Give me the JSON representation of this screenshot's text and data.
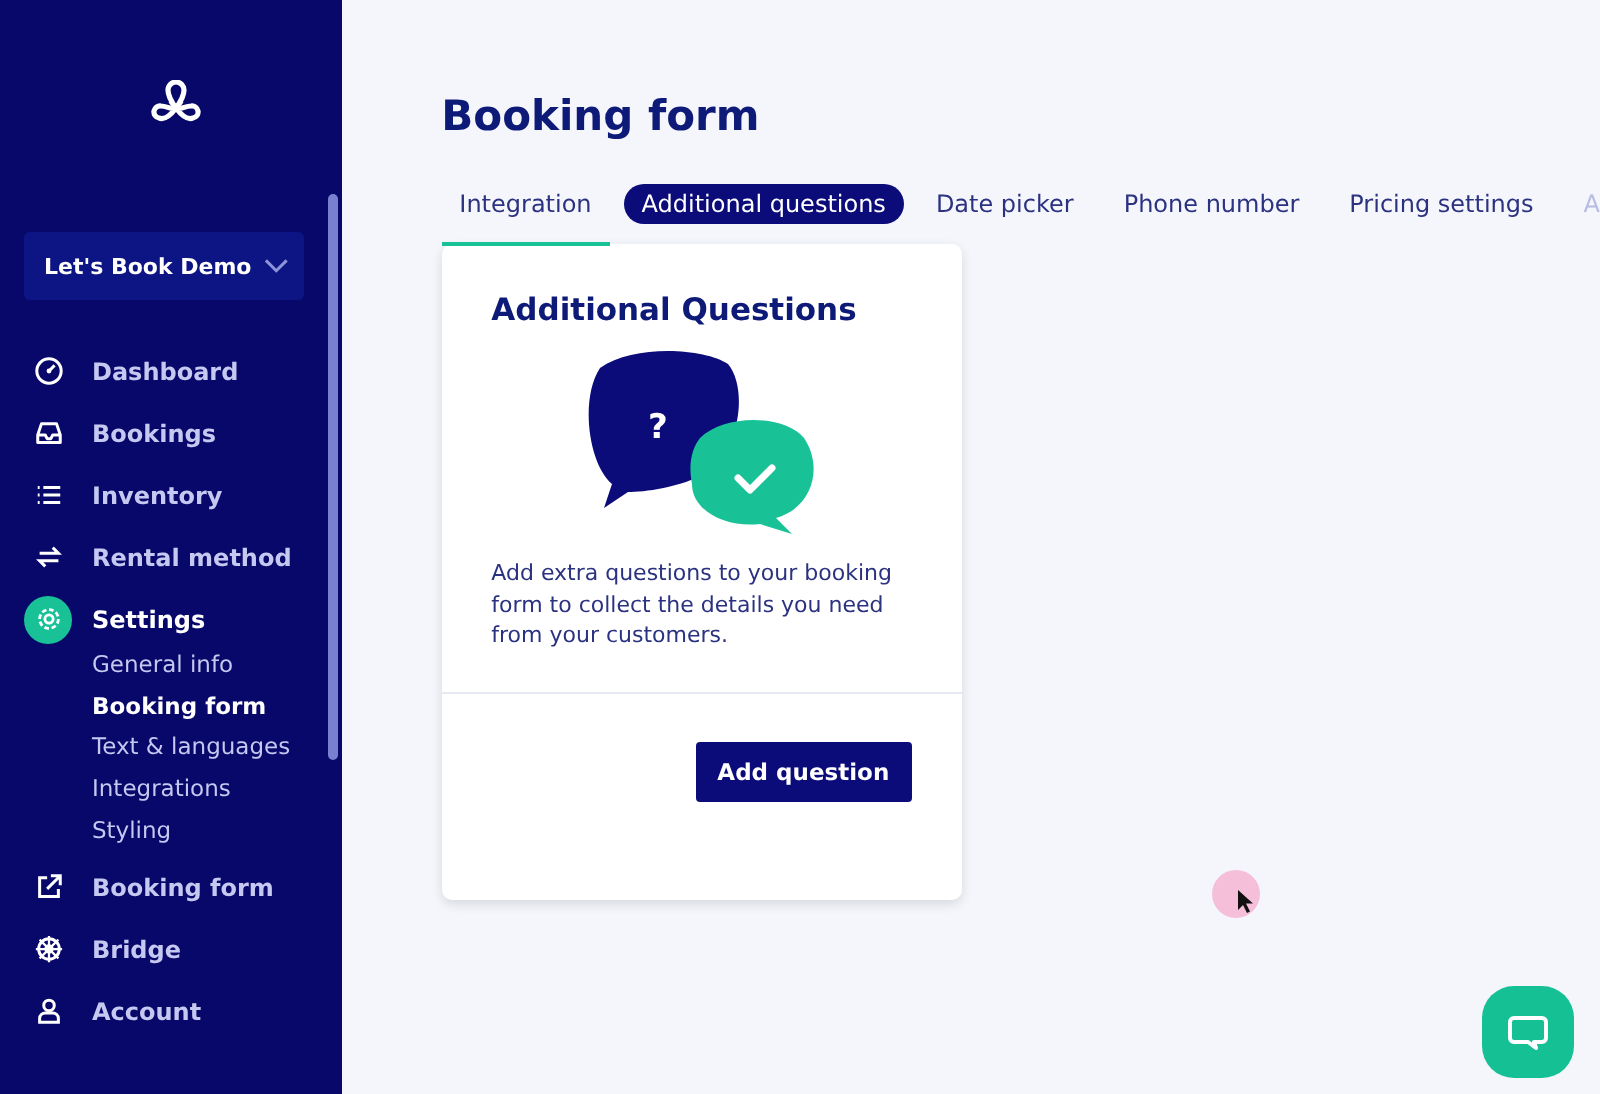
{
  "workspace": {
    "name": "Let's Book Demo"
  },
  "nav": [
    {
      "label": "Dashboard",
      "kind": "gauge",
      "selected": false
    },
    {
      "label": "Bookings",
      "kind": "inbox",
      "selected": false
    },
    {
      "label": "Inventory",
      "kind": "list",
      "selected": false
    },
    {
      "label": "Rental method",
      "kind": "swap",
      "selected": false
    },
    {
      "label": "Settings",
      "kind": "gear",
      "selected": true,
      "children": [
        {
          "label": "General info",
          "selected": false
        },
        {
          "label": "Booking form",
          "selected": true
        },
        {
          "label": "Text & languages",
          "selected": false
        },
        {
          "label": "Integrations",
          "selected": false
        },
        {
          "label": "Styling",
          "selected": false
        }
      ]
    },
    {
      "label": "Booking form",
      "kind": "external",
      "selected": false
    },
    {
      "label": "Bridge",
      "kind": "wheel",
      "selected": false
    },
    {
      "label": "Account",
      "kind": "person",
      "selected": false
    }
  ],
  "page": {
    "title": "Booking form"
  },
  "tabs": [
    {
      "label": "Integration",
      "selected": false,
      "underlined": true
    },
    {
      "label": "Additional questions",
      "selected": true,
      "underlined": false
    },
    {
      "label": "Date picker",
      "selected": false,
      "underlined": false
    },
    {
      "label": "Phone number",
      "selected": false,
      "underlined": false
    },
    {
      "label": "Pricing settings",
      "selected": false,
      "underlined": false
    },
    {
      "label": "A",
      "selected": false,
      "underlined": false
    }
  ],
  "card": {
    "title": "Additional Questions",
    "illustration_mark": "?",
    "description": "Add extra questions to your booking form to collect the details you need from your customers.",
    "button": "Add question"
  }
}
